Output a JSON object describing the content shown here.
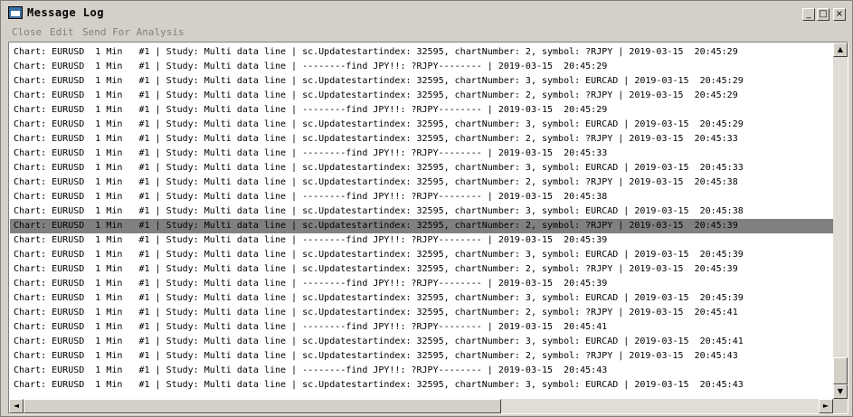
{
  "window": {
    "title": "Message Log",
    "controls": {
      "minimize": "_",
      "maximize": "□",
      "close": "×"
    }
  },
  "menu": [
    {
      "label": "Close"
    },
    {
      "label": "Edit"
    },
    {
      "label": "Send For Analysis"
    }
  ],
  "icons": {
    "app": "message-log-icon",
    "scroll_up": "▲",
    "scroll_down": "▼",
    "scroll_left": "◄",
    "scroll_right": "►"
  },
  "log": {
    "selected_index": 12,
    "lines": [
      "Chart: EURUSD  1 Min   #1 | Study: Multi data line | sc.Updatestartindex: 32595, chartNumber: 2, symbol: ?RJPY | 2019-03-15  20:45:29",
      "Chart: EURUSD  1 Min   #1 | Study: Multi data line | --------find JPY!!: ?RJPY-------- | 2019-03-15  20:45:29",
      "Chart: EURUSD  1 Min   #1 | Study: Multi data line | sc.Updatestartindex: 32595, chartNumber: 3, symbol: EURCAD | 2019-03-15  20:45:29",
      "Chart: EURUSD  1 Min   #1 | Study: Multi data line | sc.Updatestartindex: 32595, chartNumber: 2, symbol: ?RJPY | 2019-03-15  20:45:29",
      "Chart: EURUSD  1 Min   #1 | Study: Multi data line | --------find JPY!!: ?RJPY-------- | 2019-03-15  20:45:29",
      "Chart: EURUSD  1 Min   #1 | Study: Multi data line | sc.Updatestartindex: 32595, chartNumber: 3, symbol: EURCAD | 2019-03-15  20:45:29",
      "Chart: EURUSD  1 Min   #1 | Study: Multi data line | sc.Updatestartindex: 32595, chartNumber: 2, symbol: ?RJPY | 2019-03-15  20:45:33",
      "Chart: EURUSD  1 Min   #1 | Study: Multi data line | --------find JPY!!: ?RJPY-------- | 2019-03-15  20:45:33",
      "Chart: EURUSD  1 Min   #1 | Study: Multi data line | sc.Updatestartindex: 32595, chartNumber: 3, symbol: EURCAD | 2019-03-15  20:45:33",
      "Chart: EURUSD  1 Min   #1 | Study: Multi data line | sc.Updatestartindex: 32595, chartNumber: 2, symbol: ?RJPY | 2019-03-15  20:45:38",
      "Chart: EURUSD  1 Min   #1 | Study: Multi data line | --------find JPY!!: ?RJPY-------- | 2019-03-15  20:45:38",
      "Chart: EURUSD  1 Min   #1 | Study: Multi data line | sc.Updatestartindex: 32595, chartNumber: 3, symbol: EURCAD | 2019-03-15  20:45:38",
      "Chart: EURUSD  1 Min   #1 | Study: Multi data line | sc.Updatestartindex: 32595, chartNumber: 2, symbol: ?RJPY | 2019-03-15  20:45:39",
      "Chart: EURUSD  1 Min   #1 | Study: Multi data line | --------find JPY!!: ?RJPY-------- | 2019-03-15  20:45:39",
      "Chart: EURUSD  1 Min   #1 | Study: Multi data line | sc.Updatestartindex: 32595, chartNumber: 3, symbol: EURCAD | 2019-03-15  20:45:39",
      "Chart: EURUSD  1 Min   #1 | Study: Multi data line | sc.Updatestartindex: 32595, chartNumber: 2, symbol: ?RJPY | 2019-03-15  20:45:39",
      "Chart: EURUSD  1 Min   #1 | Study: Multi data line | --------find JPY!!: ?RJPY-------- | 2019-03-15  20:45:39",
      "Chart: EURUSD  1 Min   #1 | Study: Multi data line | sc.Updatestartindex: 32595, chartNumber: 3, symbol: EURCAD | 2019-03-15  20:45:39",
      "Chart: EURUSD  1 Min   #1 | Study: Multi data line | sc.Updatestartindex: 32595, chartNumber: 2, symbol: ?RJPY | 2019-03-15  20:45:41",
      "Chart: EURUSD  1 Min   #1 | Study: Multi data line | --------find JPY!!: ?RJPY-------- | 2019-03-15  20:45:41",
      "Chart: EURUSD  1 Min   #1 | Study: Multi data line | sc.Updatestartindex: 32595, chartNumber: 3, symbol: EURCAD | 2019-03-15  20:45:41",
      "Chart: EURUSD  1 Min   #1 | Study: Multi data line | sc.Updatestartindex: 32595, chartNumber: 2, symbol: ?RJPY | 2019-03-15  20:45:43",
      "Chart: EURUSD  1 Min   #1 | Study: Multi data line | --------find JPY!!: ?RJPY-------- | 2019-03-15  20:45:43",
      "Chart: EURUSD  1 Min   #1 | Study: Multi data line | sc.Updatestartindex: 32595, chartNumber: 3, symbol: EURCAD | 2019-03-15  20:45:43"
    ]
  },
  "colors": {
    "selection": "#808080",
    "menu_disabled": "#808080",
    "chrome": "#d4d0c8"
  }
}
